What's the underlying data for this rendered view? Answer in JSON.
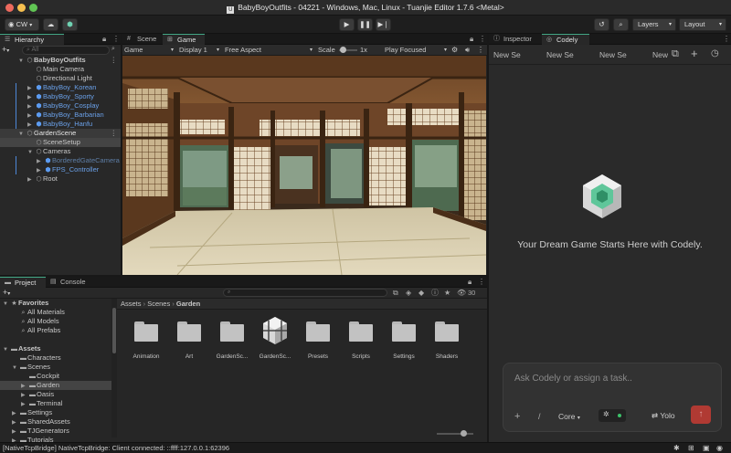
{
  "window": {
    "title": "BabyBoyOutfits - 04221 - Windows, Mac, Linux - Tuanjie Editor 1.7.6 <Metal>",
    "app_glyph": "U"
  },
  "toolbar": {
    "account": "CW",
    "layers": "Layers",
    "layout": "Layout"
  },
  "hierarchy": {
    "tab": "Hierarchy",
    "search_placeholder": "All",
    "rows": [
      {
        "label": "BabyBoyOutfits",
        "depth": 0,
        "arrow": "▼",
        "icon": "⬡",
        "style": "scene"
      },
      {
        "label": "Main Camera",
        "depth": 1,
        "arrow": "",
        "icon": "⬡",
        "style": "normal"
      },
      {
        "label": "Directional Light",
        "depth": 1,
        "arrow": "",
        "icon": "⬡",
        "style": "normal"
      },
      {
        "label": "BabyBoy_Korean",
        "depth": 1,
        "arrow": "▶",
        "icon": "⬢",
        "style": "prefab"
      },
      {
        "label": "BabyBoy_Sporty",
        "depth": 1,
        "arrow": "▶",
        "icon": "⬢",
        "style": "prefab"
      },
      {
        "label": "BabyBoy_Cosplay",
        "depth": 1,
        "arrow": "▶",
        "icon": "⬢",
        "style": "prefab"
      },
      {
        "label": "BabyBoy_Barbarian",
        "depth": 1,
        "arrow": "▶",
        "icon": "⬢",
        "style": "prefab"
      },
      {
        "label": "BabyBoy_Hanfu",
        "depth": 1,
        "arrow": "▶",
        "icon": "⬢",
        "style": "prefab"
      },
      {
        "label": "GardenScene",
        "depth": 0,
        "arrow": "▼",
        "icon": "⬡",
        "style": "sel"
      },
      {
        "label": "SceneSetup",
        "depth": 1,
        "arrow": "",
        "icon": "⬡",
        "style": "sel2"
      },
      {
        "label": "Cameras",
        "depth": 1,
        "arrow": "▼",
        "icon": "⬡",
        "style": "normal"
      },
      {
        "label": "BorderedGateCamera",
        "depth": 2,
        "arrow": "▶",
        "icon": "⬢",
        "style": "disabled"
      },
      {
        "label": "FPS_Controller",
        "depth": 2,
        "arrow": "▶",
        "icon": "⬢",
        "style": "prefab"
      },
      {
        "label": "Root",
        "depth": 1,
        "arrow": "▶",
        "icon": "⬡",
        "style": "normal"
      }
    ]
  },
  "center_tabs": {
    "scene": "Scene",
    "game": "Game"
  },
  "game_bar": {
    "display_mode": "Game",
    "display": "Display 1",
    "aspect": "Free Aspect",
    "scale_label": "Scale",
    "scale_value": "1x",
    "play_mode": "Play Focused"
  },
  "right_tabs": {
    "inspector": "Inspector",
    "codely": "Codely"
  },
  "codely": {
    "sessions": [
      "New Se",
      "New Se",
      "New Se",
      "New"
    ],
    "tagline": "Your Dream Game Starts Here with Codely.",
    "input_placeholder": "Ask Codely or assign a task..",
    "slash": "/",
    "mode": "Core",
    "yolo": "Yolo"
  },
  "project": {
    "tab_project": "Project",
    "tab_console": "Console",
    "count": "30",
    "breadcrumb": [
      "Assets",
      "Scenes",
      "Garden"
    ],
    "tree": [
      {
        "label": "Favorites",
        "depth": 0,
        "arrow": "▼",
        "icon": "★",
        "bold": true,
        "sel": false
      },
      {
        "label": "All Materials",
        "depth": 1,
        "arrow": "",
        "icon": "⌕",
        "bold": false,
        "sel": false
      },
      {
        "label": "All Models",
        "depth": 1,
        "arrow": "",
        "icon": "⌕",
        "bold": false,
        "sel": false
      },
      {
        "label": "All Prefabs",
        "depth": 1,
        "arrow": "",
        "icon": "⌕",
        "bold": false,
        "sel": false
      },
      {
        "label": "",
        "depth": 0,
        "arrow": "",
        "icon": "",
        "bold": false,
        "sel": false
      },
      {
        "label": "Assets",
        "depth": 0,
        "arrow": "▼",
        "icon": "▬",
        "bold": true,
        "sel": false
      },
      {
        "label": "Characters",
        "depth": 1,
        "arrow": "",
        "icon": "▬",
        "bold": false,
        "sel": false
      },
      {
        "label": "Scenes",
        "depth": 1,
        "arrow": "▼",
        "icon": "▬",
        "bold": false,
        "sel": false
      },
      {
        "label": "Cockpit",
        "depth": 2,
        "arrow": "",
        "icon": "▬",
        "bold": false,
        "sel": false
      },
      {
        "label": "Garden",
        "depth": 2,
        "arrow": "▶",
        "icon": "▬",
        "bold": false,
        "sel": true
      },
      {
        "label": "Oasis",
        "depth": 2,
        "arrow": "▶",
        "icon": "▬",
        "bold": false,
        "sel": false
      },
      {
        "label": "Terminal",
        "depth": 2,
        "arrow": "▶",
        "icon": "▬",
        "bold": false,
        "sel": false
      },
      {
        "label": "Settings",
        "depth": 1,
        "arrow": "▶",
        "icon": "▬",
        "bold": false,
        "sel": false
      },
      {
        "label": "SharedAssets",
        "depth": 1,
        "arrow": "▶",
        "icon": "▬",
        "bold": false,
        "sel": false
      },
      {
        "label": "TJGenerators",
        "depth": 1,
        "arrow": "▶",
        "icon": "▬",
        "bold": false,
        "sel": false
      },
      {
        "label": "Tutorials",
        "depth": 1,
        "arrow": "▶",
        "icon": "▬",
        "bold": false,
        "sel": false
      }
    ],
    "assets": [
      {
        "label": "Animation",
        "kind": "folder"
      },
      {
        "label": "Art",
        "kind": "folder"
      },
      {
        "label": "GardenSc...",
        "kind": "folder"
      },
      {
        "label": "GardenSc...",
        "kind": "scene"
      },
      {
        "label": "Presets",
        "kind": "folder"
      },
      {
        "label": "Scripts",
        "kind": "folder"
      },
      {
        "label": "Settings",
        "kind": "folder"
      },
      {
        "label": "Shaders",
        "kind": "folder"
      }
    ]
  },
  "status": {
    "message": "[NativeTcpBridge] NativeTcpBridge: Client connected: ::ffff:127.0.0.1:62396"
  },
  "colors": {
    "prefab": "#6aa0e8",
    "accent_red": "#c0392b",
    "codely_green": "#5fc69a"
  }
}
